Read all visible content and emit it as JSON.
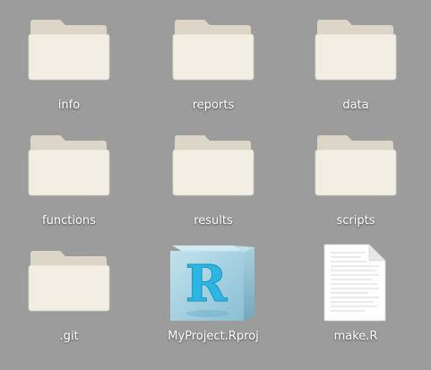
{
  "file_view": {
    "items": [
      {
        "name": "info",
        "type": "folder",
        "icon": "folder-icon"
      },
      {
        "name": "reports",
        "type": "folder",
        "icon": "folder-icon"
      },
      {
        "name": "data",
        "type": "folder",
        "icon": "folder-icon"
      },
      {
        "name": "functions",
        "type": "folder",
        "icon": "folder-icon"
      },
      {
        "name": "results",
        "type": "folder",
        "icon": "folder-icon"
      },
      {
        "name": "scripts",
        "type": "folder",
        "icon": "folder-icon"
      },
      {
        "name": ".git",
        "type": "folder",
        "icon": "folder-icon"
      },
      {
        "name": "MyProject.Rproj",
        "type": "rproj",
        "icon": "r-project-icon"
      },
      {
        "name": "make.R",
        "type": "file",
        "icon": "text-document-icon"
      }
    ]
  },
  "colors": {
    "background": "#9c9c9c",
    "folder_front": "#f2ede3",
    "folder_back": "#e2dccf",
    "label_text": "#ffffff",
    "rproj_cube": "#8ec3d9",
    "rproj_letter": "#2ab7e6"
  },
  "rproj": {
    "letter": "R"
  }
}
